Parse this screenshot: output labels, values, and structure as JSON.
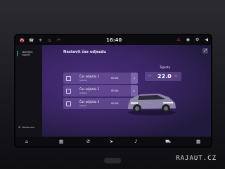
{
  "status_bar": {
    "time": "16:40"
  },
  "sidebar": {
    "active_item": "Nabíjení, topení",
    "bottom_item": "Nastavení"
  },
  "main": {
    "title": "Nastavit čas odjezdu",
    "departures": [
      {
        "label": "Čas odjezdu 1",
        "days": "Sobota",
        "time": "00:00"
      },
      {
        "label": "Čas odjezdu 2",
        "days": "Sobota",
        "time": "00:00"
      },
      {
        "label": "Čas odjezdu 3",
        "days": "Sobota",
        "time": "00:00"
      }
    ],
    "temperature": {
      "label": "Teplota",
      "value": "22.0",
      "minus": "−",
      "plus": "+"
    }
  },
  "watermark": "RAJAUT.CZ",
  "icons": {
    "accent_green": "#2fd36b",
    "minus_color": "#6fb6ff",
    "plus_color": "#ff5d5d"
  }
}
